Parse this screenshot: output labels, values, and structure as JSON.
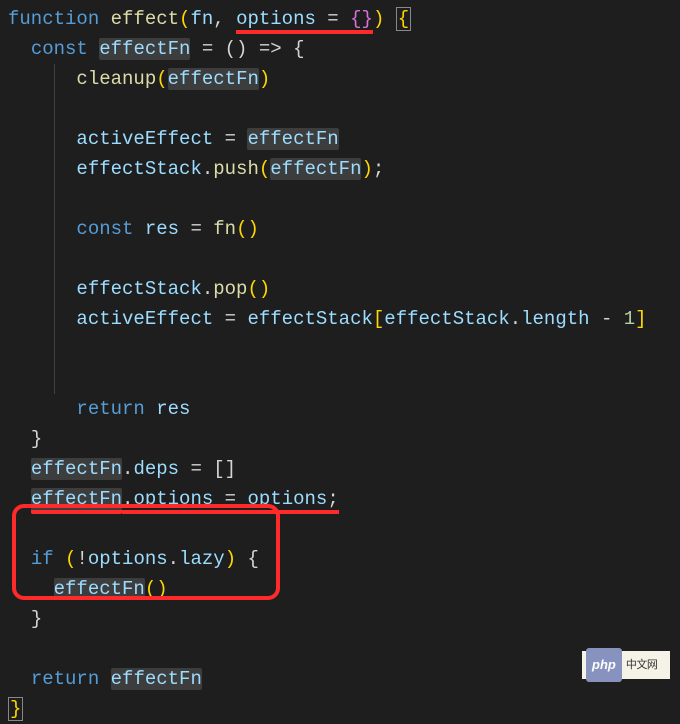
{
  "code": {
    "l1": {
      "kw": "function",
      "name": "effect",
      "p1": "fn",
      "p2": "options",
      "eq": " = ",
      "obj": "{}"
    },
    "l2": {
      "kw": "const",
      "v": "effectFn",
      "arrow": " = () => {"
    },
    "l3": {
      "fn": "cleanup",
      "arg": "effectFn"
    },
    "l5": {
      "lhs": "activeEffect",
      "rhs": "effectFn"
    },
    "l6": {
      "obj": "effectStack",
      "m": "push",
      "arg": "effectFn"
    },
    "l8": {
      "kw": "const",
      "v": "res",
      "fn": "fn"
    },
    "l10": {
      "obj": "effectStack",
      "m": "pop"
    },
    "l11": {
      "lhs": "activeEffect",
      "obj": "effectStack",
      "idx_obj": "effectStack",
      "prop": "length",
      "minus": "1"
    },
    "l13": {
      "kw": "return",
      "v": "res"
    },
    "l15": {
      "obj": "effectFn",
      "prop": "deps",
      "val": "[]"
    },
    "l16": {
      "obj": "effectFn",
      "prop": "options",
      "rhs": "options"
    },
    "l18": {
      "kw": "if",
      "neg": "!",
      "obj": "options",
      "prop": "lazy"
    },
    "l19": {
      "fn": "effectFn"
    },
    "l22": {
      "kw": "return",
      "v": "effectFn"
    }
  },
  "watermark": {
    "label": "php",
    "suffix": "中文网"
  }
}
